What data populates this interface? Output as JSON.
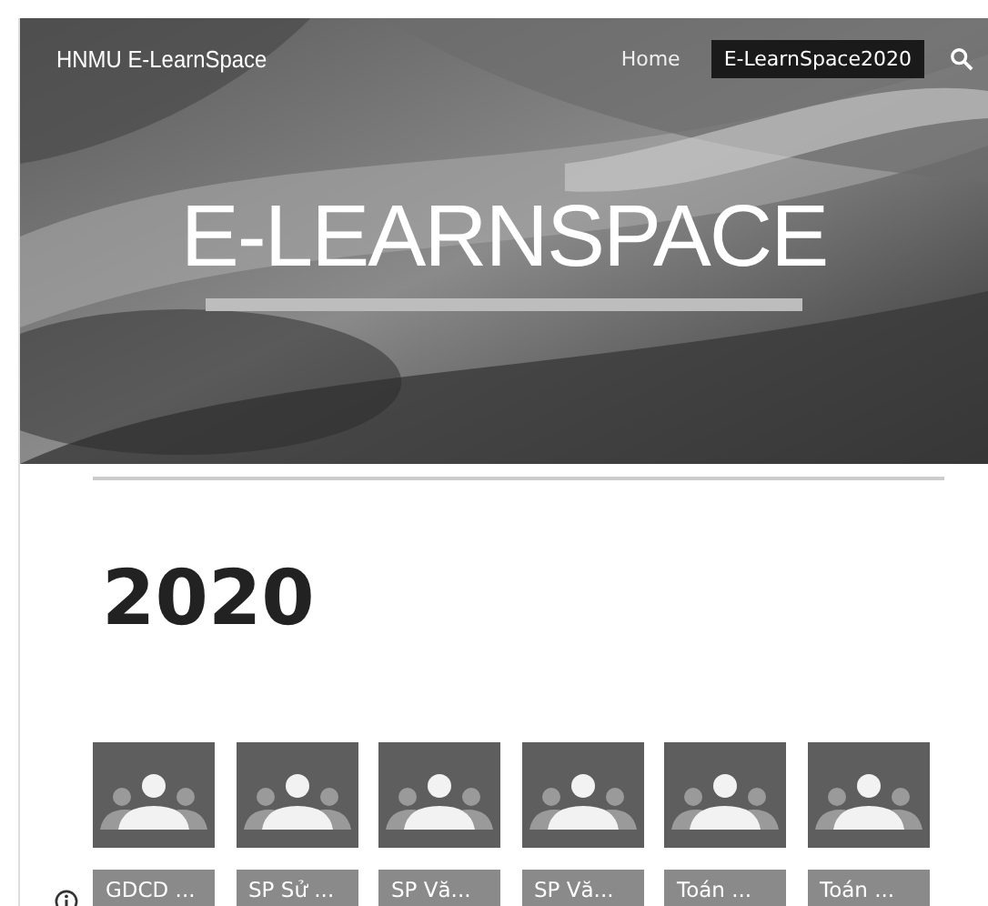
{
  "site_title": "HNMU E-LearnSpace",
  "nav": [
    {
      "label": "Home",
      "selected": false
    },
    {
      "label": "E-LearnSpace2020",
      "selected": true
    }
  ],
  "hero": {
    "kind": "picture",
    "title": "E-LEARNSPACE"
  },
  "heading": "2020",
  "classes": [
    {
      "label": "GDCD ..."
    },
    {
      "label": "SP Sử ..."
    },
    {
      "label": "SP Vă..."
    },
    {
      "label": "SP Vă..."
    },
    {
      "label": "Toán ..."
    },
    {
      "label": "Toán ..."
    }
  ]
}
